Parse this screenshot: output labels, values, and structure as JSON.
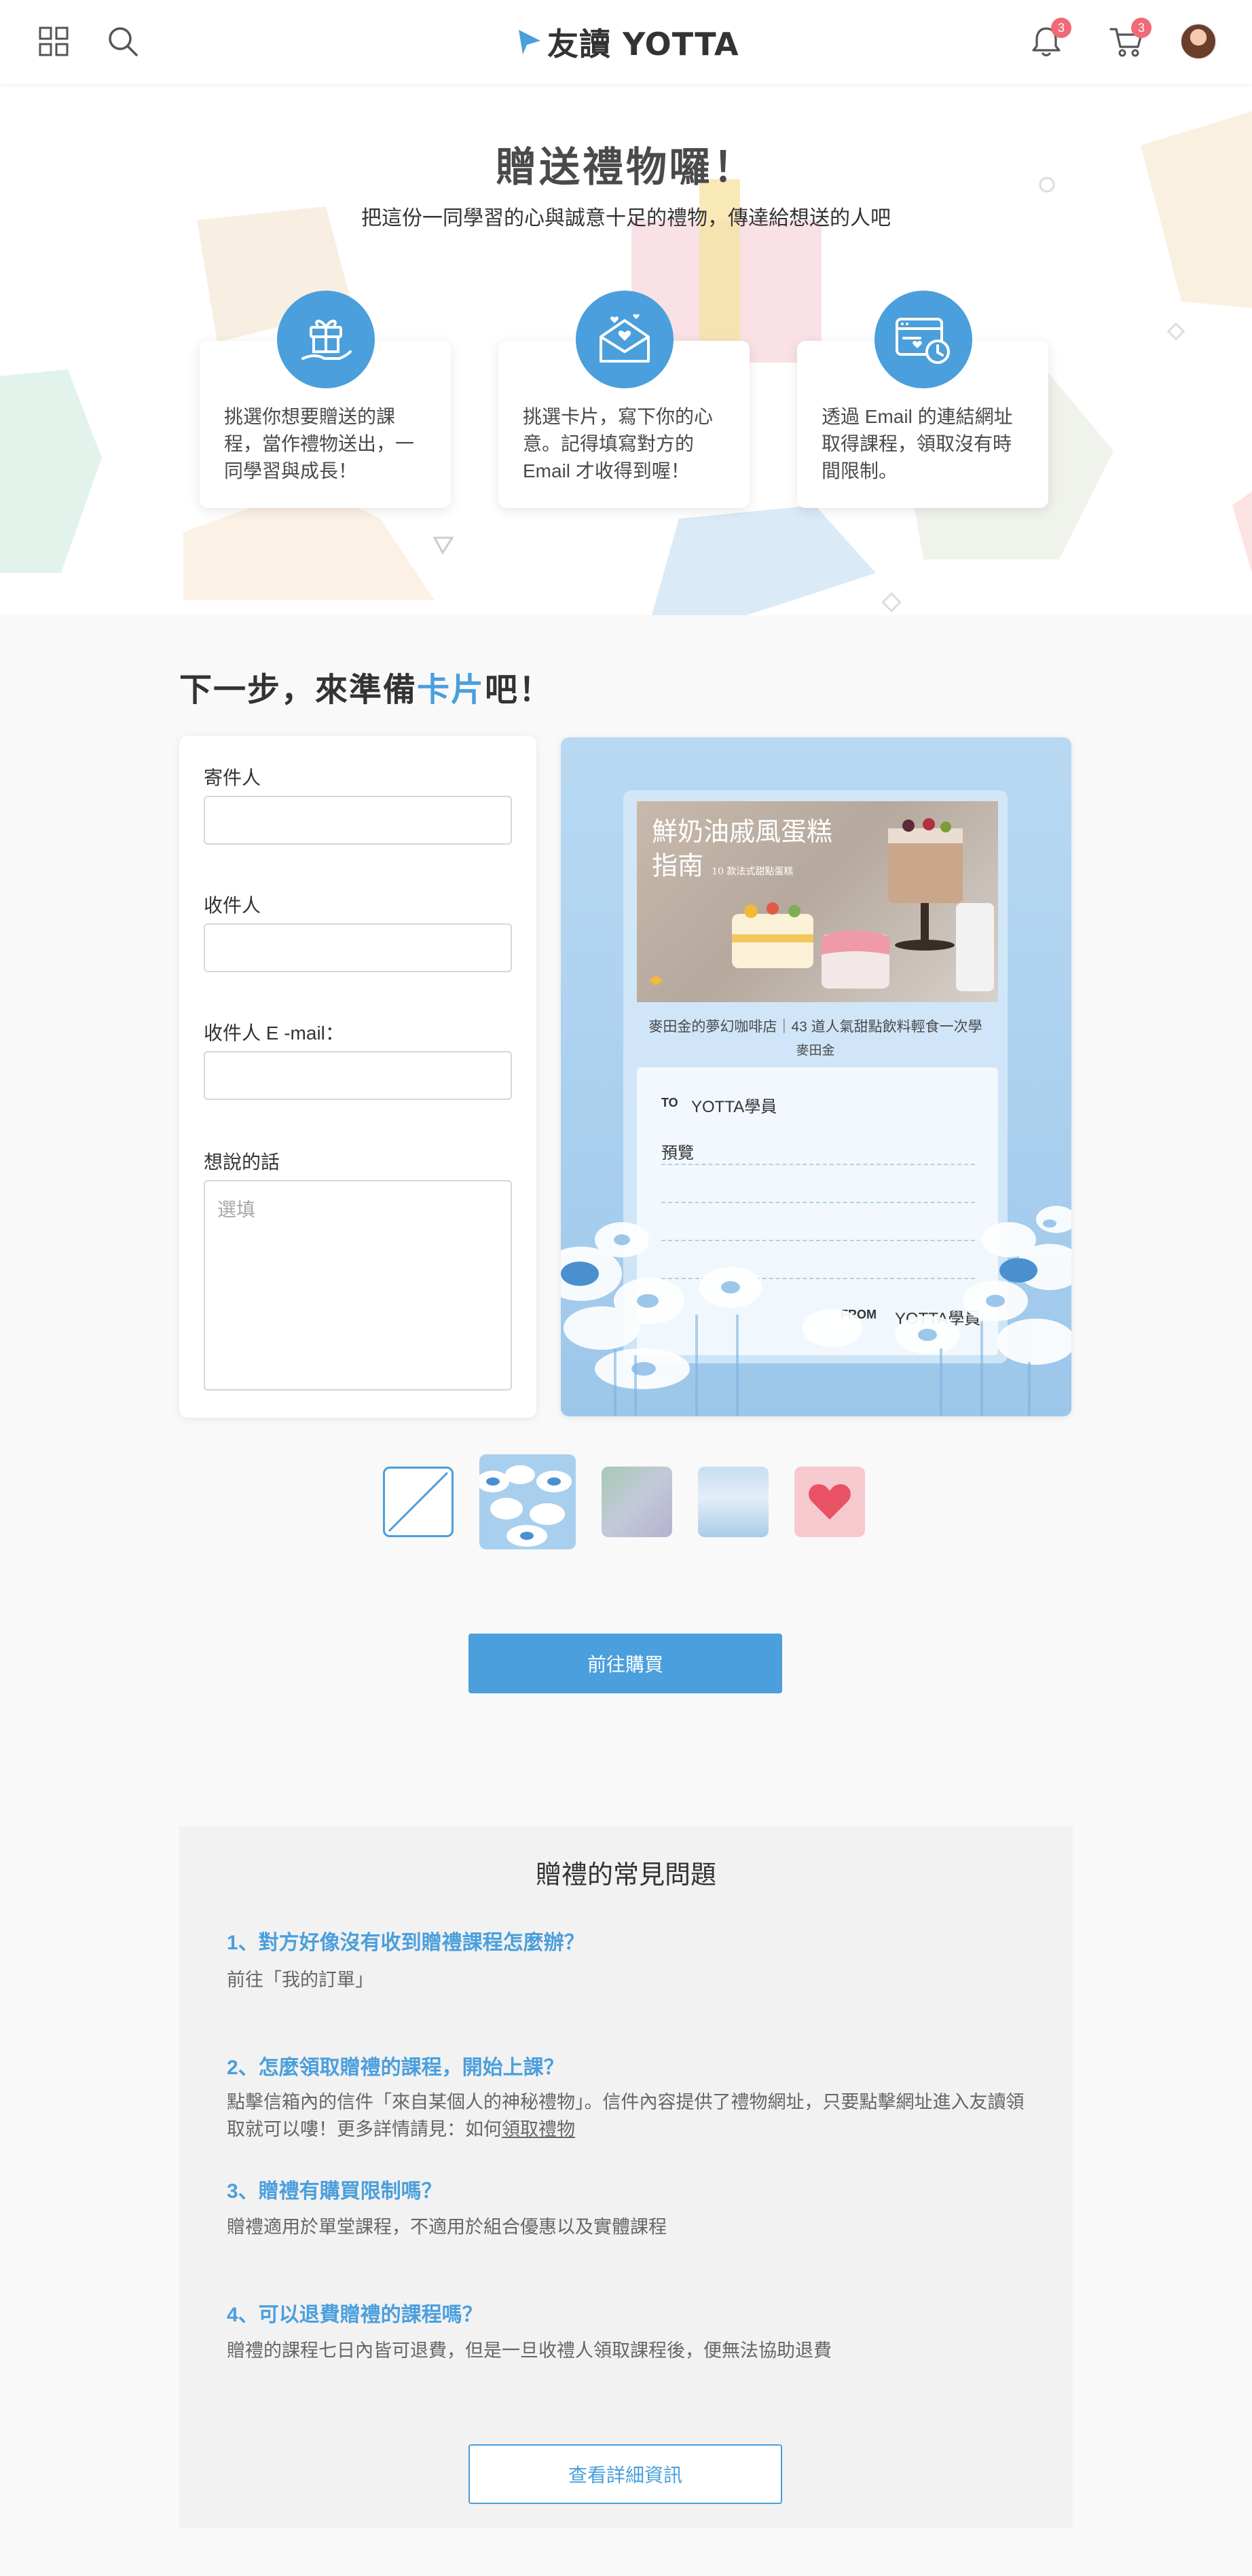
{
  "header": {
    "logo_text": "友讀 YOTTA",
    "notification_count": "3",
    "cart_count": "3"
  },
  "hero": {
    "title": "贈送禮物囉！",
    "subtitle": "把這份一同學習的心與誠意十足的禮物，傳達給想送的人吧",
    "steps": [
      {
        "text": "挑選你想要贈送的課程，當作禮物送出，一同學習與成長！"
      },
      {
        "text": "挑選卡片，寫下你的心意。記得填寫對方的 Email 才收得到喔！"
      },
      {
        "text": "透過 Email 的連結網址取得課程，領取沒有時間限制。"
      }
    ]
  },
  "card_section": {
    "title_prefix": "下一步，來準備",
    "title_highlight": "卡片",
    "title_suffix": "吧！"
  },
  "form": {
    "sender_label": "寄件人",
    "sender_value": "",
    "recipient_label": "收件人",
    "recipient_value": "",
    "email_label": "收件人 E -mail：",
    "email_value": "",
    "message_label": "想說的話",
    "message_placeholder": "選填"
  },
  "preview": {
    "course_image_title_1": "鮮奶油戚風蛋糕",
    "course_image_title_2": "指南",
    "course_image_subtitle": "10 款法式甜點蛋糕",
    "course_caption": "麥田金的夢幻咖啡店｜43 道人氣甜點飲料輕食一次學",
    "course_author": "麥田金",
    "to_tag": "TO",
    "to_name": "YOTTA學員",
    "message": "預覽",
    "from_tag": "FROM",
    "from_name": "YOTTA學員"
  },
  "colors": {
    "accent": "#4a9fdc",
    "badge": "#f06a77"
  },
  "actions": {
    "buy_label": "前往購買"
  },
  "faq": {
    "title": "贈禮的常見問題",
    "items": [
      {
        "q": "1、對方好像沒有收到贈禮課程怎麼辦？",
        "a": "前往「我的訂單」"
      },
      {
        "q": "2、怎麼領取贈禮的課程，開始上課？",
        "a": "點擊信箱內的信件「來自某個人的神秘禮物」。信件內容提供了禮物網址，只要點擊網址進入友讀領取就可以嘍！更多詳情請見：如何",
        "link": "領取禮物"
      },
      {
        "q": "3、贈禮有購買限制嗎？",
        "a": "贈禮適用於單堂課程，不適用於組合優惠以及實體課程"
      },
      {
        "q": "4、可以退費贈禮的課程嗎？",
        "a": "贈禮的課程七日內皆可退費，但是一旦收禮人領取課程後，便無法協助退費"
      }
    ],
    "detail_label": "查看詳細資訊"
  }
}
